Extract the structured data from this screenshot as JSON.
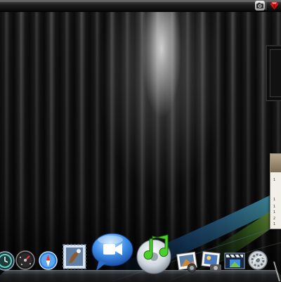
{
  "desktop": {
    "wallpaper": "black-curtain-aurora",
    "colors": {
      "aurora_blue": "#2f7fd6",
      "aurora_green": "#6fc23a",
      "aurora_cyan": "#5fd0e0"
    }
  },
  "menubar": {
    "status_icons": [
      {
        "name": "camera-icon"
      },
      {
        "name": "ruby-icon",
        "color": "#d01818"
      }
    ]
  },
  "dock": {
    "items": [
      {
        "name": "time-machine-icon"
      },
      {
        "name": "dashboard-icon"
      },
      {
        "name": "safari-icon"
      },
      {
        "name": "mail-icon"
      },
      {
        "name": "ichat-icon",
        "color": "#3f8fe8"
      },
      {
        "name": "itunes-icon",
        "color": "#4bd02a"
      },
      {
        "name": "iphoto-icon"
      },
      {
        "name": "image-capture-icon"
      },
      {
        "name": "imovie-icon"
      },
      {
        "name": "system-preferences-icon"
      }
    ]
  },
  "doc_window": {
    "lines": [
      "1",
      "1",
      "1",
      "1",
      "2",
      "1"
    ]
  }
}
